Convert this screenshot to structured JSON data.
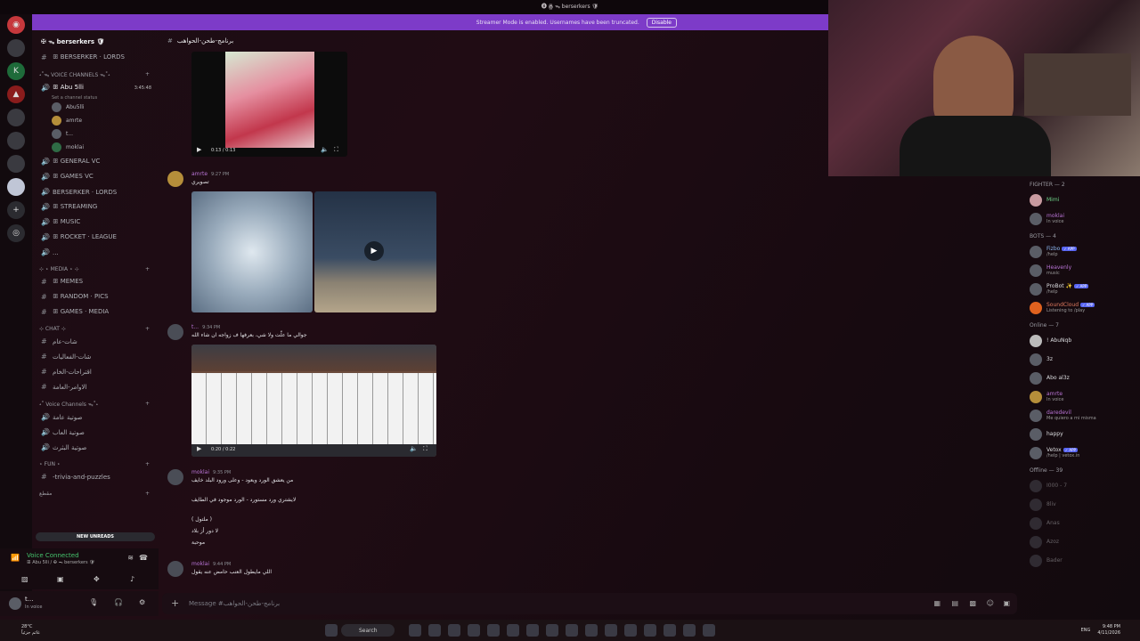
{
  "window": {
    "title": "🅑 ꙮ ᯓ berserkers 🛡"
  },
  "banner": {
    "text": "Streamer Mode is enabled. Usernames have been truncated.",
    "disable_label": "Disable"
  },
  "server": {
    "name": "✠ ᯓ berserkers 🛡"
  },
  "channels": {
    "top": "ꕥ BERSERKER · LORDS",
    "voice_category": "˖˚ᯓ VOICE CHANNELS ᯓ˚˖",
    "active_voice": {
      "name": "ꕥ Abu 5lli",
      "timer": "3:45:48",
      "status": "Set a channel status"
    },
    "voice_users": [
      "Abu5lli",
      "amrte",
      "t...",
      "moklai"
    ],
    "voice_channels": [
      "ꕥ GENERAL VC",
      "ꕥ GAMES VC",
      "BERSERKER · LORDS",
      "ꕥ STREAMING",
      "ꕥ MUSIC",
      "ꕥ ROCKET · LEAGUE",
      "..."
    ],
    "media_category": "⊹ ⋆ MEDIA ⋆ ⊹",
    "media_channels": [
      "ꕥ MEMES",
      "ꕥ RANDOM · PICS",
      "ꕥ GAMES · MEDIA"
    ],
    "chat_category": "⊹ CHAT ⊹",
    "chat_channels": [
      "شات-عام",
      "شات-الفعاليات",
      "اقتراحات-الخام",
      "الاوامر-العامة"
    ],
    "voice2_category": "˖˚ Voice Channels ᯓ˚˖",
    "voice2_channels": [
      "صوتية عامة",
      "صوتية العاب",
      "صوتية البثرث"
    ],
    "fun_category": "⋆ FUN ⋆",
    "fun_channels": [
      "-trivia-and-puzzles"
    ],
    "misc_category": "مقطع",
    "new_unreads": "NEW UNREADS"
  },
  "voice_panel": {
    "status": "Voice Connected",
    "channel": "ꕥ Abu 5lli / ✠ ᯓ berserkers 🛡"
  },
  "user_panel": {
    "name": "t...",
    "status": "In voice"
  },
  "chat": {
    "channel": "برنامج-طحن-الحواهب",
    "messages": [
      {
        "author": "amrte",
        "time": "9:27 PM",
        "text": "تصويري"
      },
      {
        "author": "t...",
        "time": "9:34 PM",
        "text": "جوالي ما علّت ولا شي، بعرفها ف زواجه ان شاء الله"
      },
      {
        "author": "moklai",
        "time": "9:35 PM",
        "text": "من يعشق الورد ويعود - وعلى ورود البلد خايف",
        "line2": "لايشتري ورد مستورد - الورد موجود في الطايف",
        "line3": "( ملتول )",
        "line4": "لا دور أز بلاد",
        "line5": "موحبة"
      },
      {
        "author": "moklai",
        "time": "9:44 PM",
        "text": "اللي مايطول العنب حامض عنه يقول"
      }
    ],
    "video1_time": "0:13 / 0:13",
    "video2_time": "0:20 / 0:22",
    "input_placeholder": "Message #برنامج-طحن-الحواهب"
  },
  "members": {
    "fighter_header": "FIGHTER — 2",
    "fighters": [
      {
        "name": "Mimi",
        "status": ""
      },
      {
        "name": "moklai",
        "status": "In voice"
      }
    ],
    "bots_header": "BOTS — 4",
    "bots": [
      {
        "name": "Fizbo",
        "status": "/help"
      },
      {
        "name": "Heavenly",
        "status": "music"
      },
      {
        "name": "ProBot ✨",
        "status": "/help"
      },
      {
        "name": "SoundCloud",
        "status": "Listening to /play"
      }
    ],
    "online_header": "Online — 7",
    "online": [
      {
        "name": "! AbuNqb",
        "status": ""
      },
      {
        "name": "3z",
        "status": ""
      },
      {
        "name": "Abo al3z",
        "status": ""
      },
      {
        "name": "amrte",
        "status": "In voice"
      },
      {
        "name": "daredevil",
        "status": "Me quiero a mi misma"
      },
      {
        "name": "happy",
        "status": ""
      },
      {
        "name": "Vetox",
        "status": "/help | vetox.in"
      }
    ],
    "offline_header": "Offline — 39",
    "offline": [
      {
        "name": "I000 - 7"
      },
      {
        "name": "8liv"
      },
      {
        "name": "Anas"
      },
      {
        "name": "Azoz"
      },
      {
        "name": "Bader"
      }
    ],
    "bot_badge": "✓ APP"
  },
  "taskbar": {
    "weather": "28°C",
    "weather_sub": "غائم جزئياً",
    "search": "Search",
    "lang": "ENG",
    "time": "9:48 PM",
    "date": "4/11/2026"
  },
  "colors": {
    "accent": "#7d3bc8",
    "author": "#b974d6",
    "online": "#45c46d"
  }
}
